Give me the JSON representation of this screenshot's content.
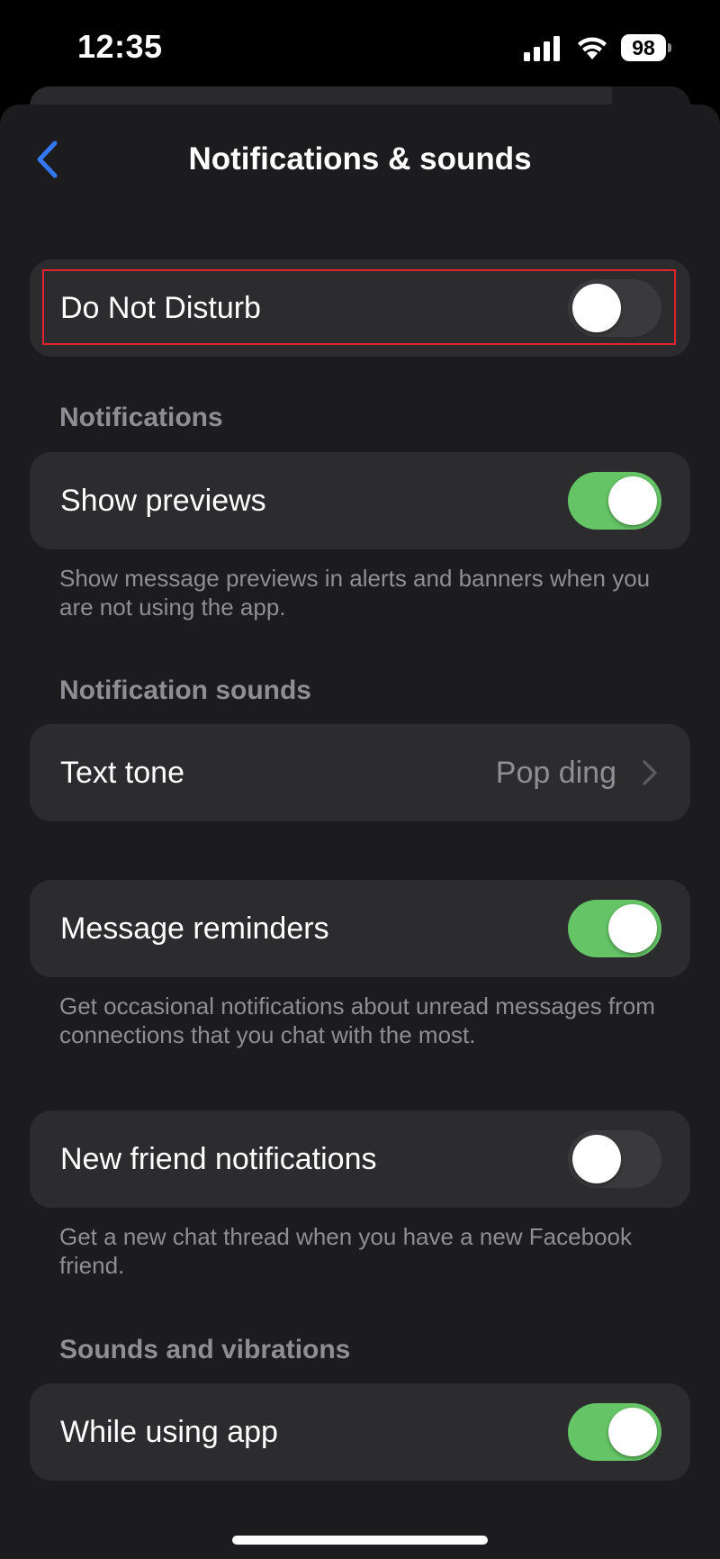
{
  "status_bar": {
    "time": "12:35",
    "battery": "98"
  },
  "nav": {
    "title": "Notifications & sounds",
    "back_icon": "chevron-left-icon",
    "accent_color": "#3478f6"
  },
  "do_not_disturb": {
    "label": "Do Not Disturb",
    "enabled": false
  },
  "notifications": {
    "header": "Notifications",
    "show_previews": {
      "label": "Show previews",
      "enabled": true
    },
    "footnote": "Show message previews in alerts and banners when you are not using the app."
  },
  "notification_sounds": {
    "header": "Notification sounds",
    "text_tone": {
      "label": "Text tone",
      "value": "Pop ding"
    }
  },
  "message_reminders": {
    "label": "Message reminders",
    "enabled": true,
    "footnote": "Get occasional notifications about unread messages from connections that you chat with the most."
  },
  "new_friend": {
    "label": "New friend notifications",
    "enabled": false,
    "footnote": "Get a new chat thread when you have a new Facebook friend."
  },
  "sounds_vibrations": {
    "header": "Sounds and vibrations",
    "while_using_app": {
      "label": "While using app",
      "enabled": true
    }
  },
  "colors": {
    "toggle_on": "#65c466",
    "toggle_off": "#3a3a3c",
    "highlight": "#e0242f"
  }
}
